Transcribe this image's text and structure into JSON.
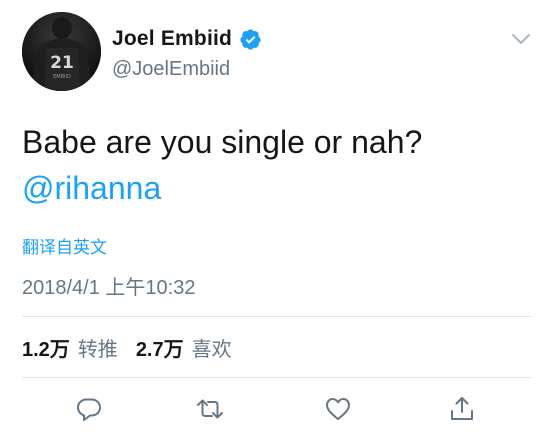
{
  "header": {
    "display_name": "Joel Embiid",
    "handle": "@JoelEmbiid",
    "avatar_jersey_number": "21",
    "avatar_jersey_name": "EMBIID"
  },
  "tweet": {
    "text": "Babe are you single or nah?",
    "mention": "@rihanna",
    "translate_label": "翻译自英文",
    "timestamp": "2018/4/1 上午10:32"
  },
  "stats": {
    "retweets_count": "1.2万",
    "retweets_label": "转推",
    "likes_count": "2.7万",
    "likes_label": "喜欢"
  },
  "icons": {
    "verified": "verified-badge-icon",
    "caret": "chevron-down-icon",
    "reply": "reply-icon",
    "retweet": "retweet-icon",
    "like": "heart-icon",
    "share": "share-icon"
  },
  "colors": {
    "accent": "#1da1f2",
    "text_primary": "#14171a",
    "text_secondary": "#657786",
    "divider": "#e1e8ed",
    "caret": "#aab8c2"
  }
}
